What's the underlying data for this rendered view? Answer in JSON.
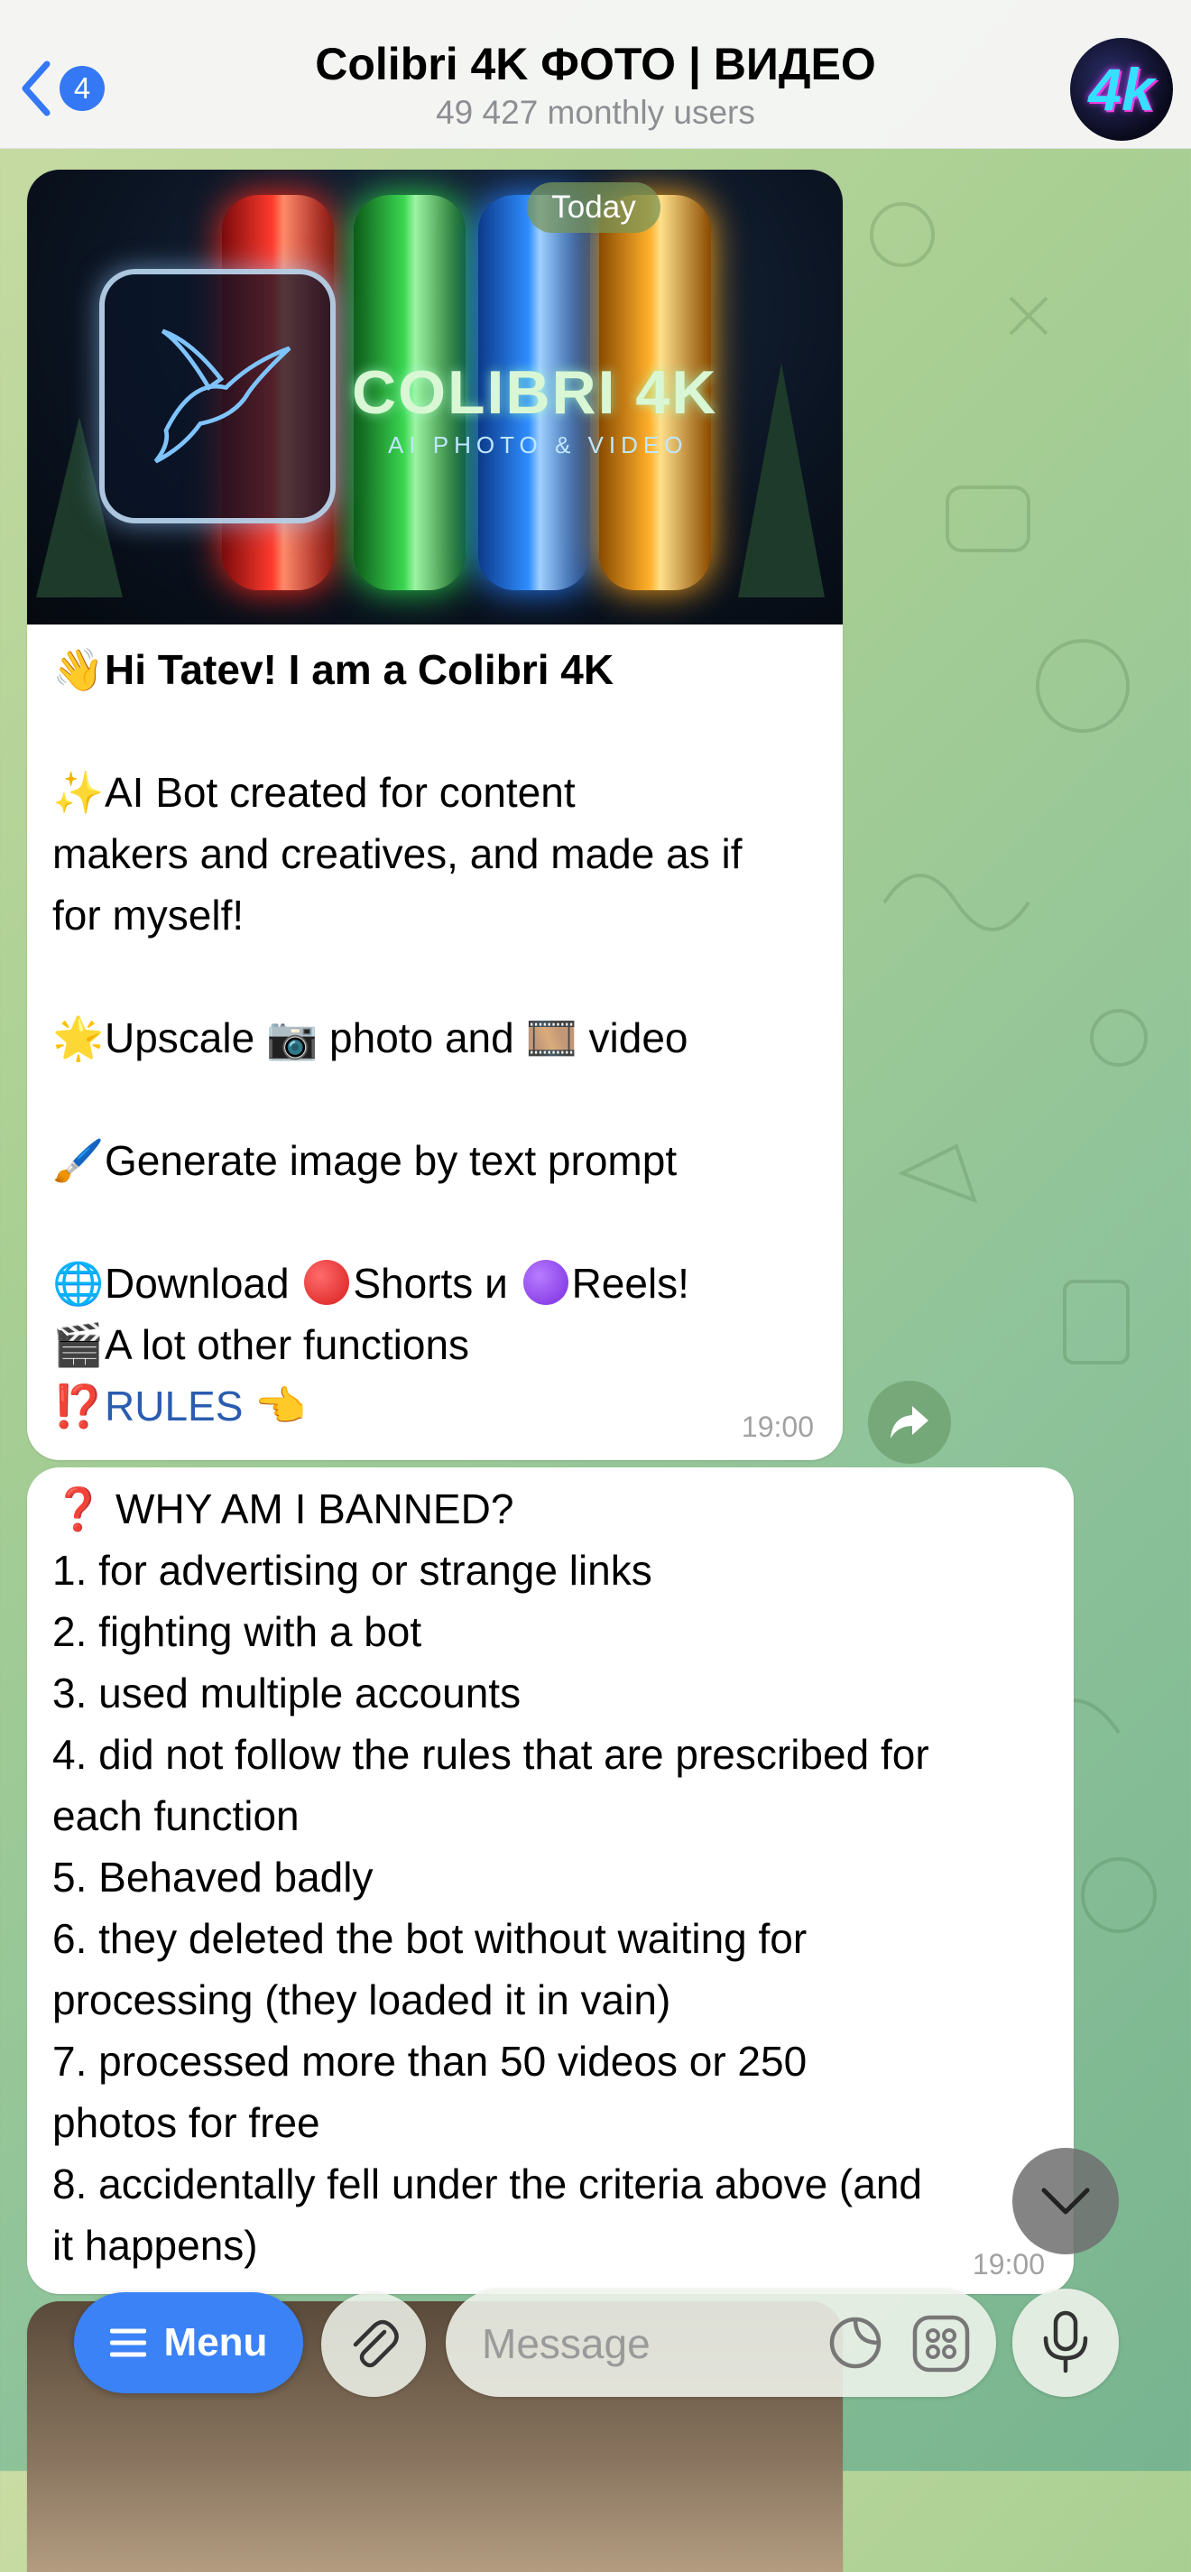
{
  "header": {
    "back_count": "4",
    "title": "Colibri 4K ФОТО | ВИДЕО",
    "subtitle": "49 427 monthly users",
    "avatar_text": "4k"
  },
  "date_pill": "Today",
  "banner": {
    "brand": "COLIBRI 4K",
    "tagline": "AI PHOTO & VIDEO"
  },
  "message1": {
    "greeting_emoji": "👋",
    "greeting": "Hi Tatev! I am a Colibri 4K",
    "intro_emoji": "✨",
    "intro_l1": "AI Bot created for content",
    "intro_l2": "makers and creatives, and made as if",
    "intro_l3": "for myself!",
    "upscale_emoji": "🌟",
    "upscale_a": "Upscale",
    "camera_emoji": "📷",
    "upscale_b": "photo and",
    "film_emoji": "🎞️",
    "upscale_c": "video",
    "generate_emoji": "🖌️",
    "generate": "Generate image by text prompt",
    "download_emoji": "🌐",
    "download_a": "Download",
    "download_b": "Shorts и",
    "download_c": "Reels!",
    "functions_emoji": "🎬",
    "functions": "A lot other functions",
    "rules_emoji": "⁉️",
    "rules_link": "RULES",
    "rules_pointer": "👈",
    "time": "19:00"
  },
  "message2": {
    "lines": [
      "❓ WHY AM I BANNED?",
      "1. for advertising or strange links",
      "2. fighting with a bot",
      "3. used multiple accounts",
      "4. did not follow the rules that are prescribed for",
      "each function",
      "5. Behaved badly",
      "6. they deleted the bot without waiting for",
      "processing (they loaded it in vain)",
      "7. processed more than 50 videos or 250",
      "photos for free",
      "8. accidentally fell under the criteria above (and",
      "it happens)"
    ],
    "time": "19:00"
  },
  "input_bar": {
    "menu_label": "Menu",
    "message_placeholder": "Message"
  },
  "colors": {
    "accent": "#3b82f6",
    "link": "#2a5db0",
    "badge": "#3478f6"
  },
  "icons": [
    "back-chevron-icon",
    "menu-lines-icon",
    "paperclip-icon",
    "sticker-icon",
    "apps-grid-icon",
    "microphone-icon",
    "share-arrow-icon",
    "chevron-down-icon"
  ]
}
